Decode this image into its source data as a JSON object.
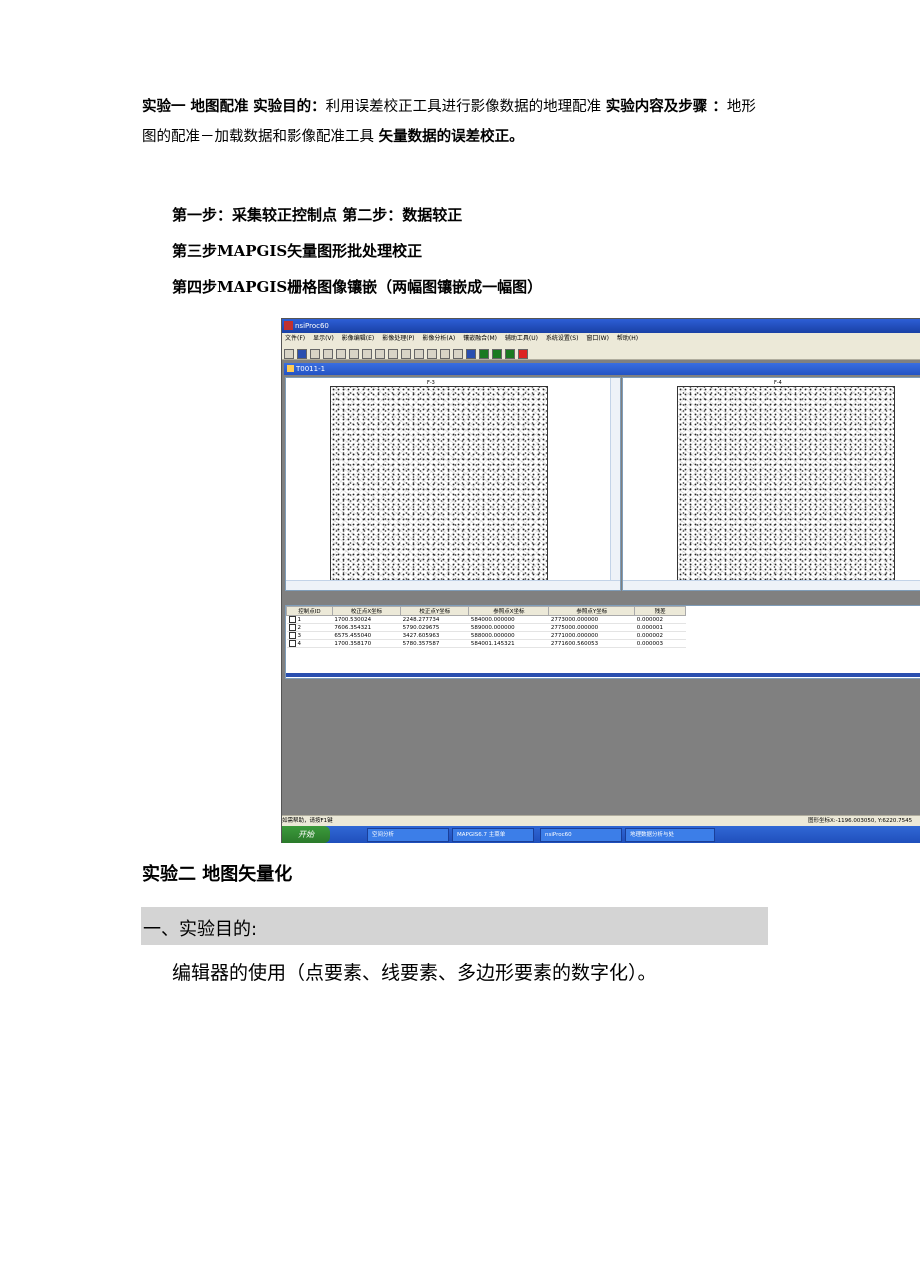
{
  "intro": {
    "exp1_title": "实验一 地图配准",
    "purpose_label": "实验目的：",
    "purpose_text": "利用误差校正工具进行影像数据的地理配准",
    "content_label": "实验内容及步骤 ：",
    "content_text": "地形图的配准－加载数据和影像配准工具",
    "tail_bold": "矢量数据的误差校正。"
  },
  "steps": [
    "第一步：采集较正控制点 第二步：数据较正",
    "第三步MAPGIS矢量图形批处理校正",
    "第四步MAPGIS栅格图像镶嵌（两幅图镶嵌成一幅图）"
  ],
  "screenshot": {
    "app_title": "nsiProc60",
    "menu": [
      "文件(F)",
      "显示(V)",
      "影像编辑(E)",
      "影像处理(P)",
      "影像分析(A)",
      "镶嵌融合(M)",
      "辅助工具(U)",
      "系统设置(S)",
      "窗口(W)",
      "帮助(H)"
    ],
    "doc_title": "T0011-1",
    "map_label_left": "F-3",
    "map_label_right": "F-4",
    "table_headers": [
      "控制点ID",
      "校正点X坐标",
      "校正点Y坐标",
      "参照点X坐标",
      "参照点Y坐标",
      "残差"
    ],
    "table_rows": [
      [
        "1",
        "1700.530024",
        "2248.277734",
        "584000.000000",
        "2773000.000000",
        "0.000002"
      ],
      [
        "2",
        "7606.354321",
        "5790.029675",
        "589000.000000",
        "2775000.000000",
        "0.000001"
      ],
      [
        "3",
        "6575.455040",
        "3427.605963",
        "588000.000000",
        "2771000.000000",
        "0.000002"
      ],
      [
        "4",
        "1700.358170",
        "5780.357587",
        "584001.145321",
        "2771600.560053",
        "0.000003"
      ]
    ],
    "status_left": "如需帮助，请按F1键",
    "status_right": "图形坐标X:-1196.003050, Y:6220.7545",
    "start_label": "开始",
    "tasks": [
      "空间分析",
      "MAPGIS6.7 主菜单",
      "nsiProc60",
      "地理数据分析与处"
    ]
  },
  "exp2": {
    "title": "实验二 地图矢量化",
    "section_title": "一、实验目的:",
    "body": "编辑器的使用（点要素、线要素、多边形要素的数字化）。"
  }
}
